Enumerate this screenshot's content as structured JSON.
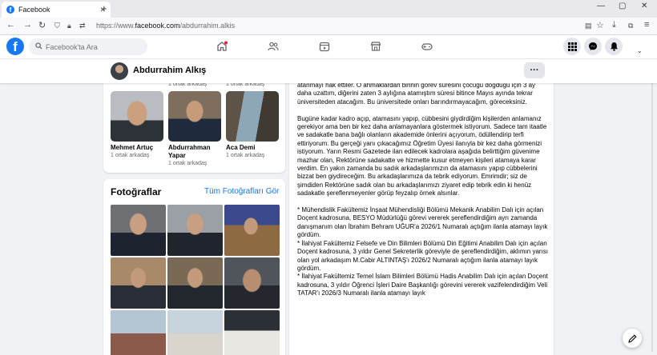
{
  "browser": {
    "tab_title": "Facebook",
    "tab_close": "✕",
    "new_tab": "+",
    "url_prefix": "https://www.",
    "url_host": "facebook.com",
    "url_path": "/abdurrahim.alkis",
    "window_controls": [
      "—",
      "▢",
      "✕"
    ]
  },
  "fb": {
    "search_placeholder": "Facebook'ta Ara",
    "accent": "#1877f2",
    "nav_icons": [
      "home-icon",
      "friends-icon",
      "watch-icon",
      "marketplace-icon",
      "gaming-icon"
    ],
    "right_icons": [
      "menu-grid-icon",
      "messenger-icon",
      "notifications-icon"
    ]
  },
  "profile": {
    "name": "Abdurrahim Alkış",
    "more": "···"
  },
  "friends": {
    "top_mutuals": [
      "1 ortak arkadaş",
      "1 ortak arkadaş"
    ],
    "items": [
      {
        "name": "Mehmet Artuç",
        "mutual": "1 ortak arkadaş"
      },
      {
        "name": "Abdurrahman Yapar",
        "mutual": "1 ortak arkadaş"
      },
      {
        "name": "Aca Demi",
        "mutual": "1 ortak arkadaş"
      }
    ]
  },
  "photos": {
    "title": "Fotoğraflar",
    "see_all": "Tüm Fotoğrafları Gör"
  },
  "post": {
    "paragraphs": [
      "atanmayı hak ettiler. O ahmaklardan birinin görev süresini çocuğu doğduğu için 3 ay daha uzattım, diğerini zaten 3 aylığına atamıştım süresi bitince Mayıs ayında tekrar üniversiteden atacağım. Bu üniversitede onları barındırmayacağım, göreceksiniz.",
      "Bugüne kadar kadro açıp, atamasını yapıp, cübbesini giydirdiğim kişilerden anlamanız gerekiyor ama ben bir kez daha anlamayanlara göstermek istiyorum. Sadece tam itaatle ve sadakatle bana bağlı olanların akademide önlerini açıyorum, ödüllendirip terfi ettiriyorum. Bu gerçeği yanı çıkacağımız Öğretim Üyesi ilanıyla bir kez daha görmenizi istiyorum. Yarın Resmi Gazetede ilan edilecek kadrolara aşağıda belirttiğim güvenime mazhar olan, Rektörüne sadakatte ve hizmette kusur etmeyen kişileri atamaya karar verdim. En yakın zamanda bu sadık arkadaşlarımızın da atamasını yapıp cübbelerini bizzat ben giydireceğim. Bu arkadaşlarımıza da tebrik ediyorum. Emrimdir; siz de şimdiden Rektörüne sadık olan bu arkadaşlarımızı ziyaret edip tebrik edin ki henüz sadakatle şereflenmeyenler görüp feyzalıp örnek alsınlar.",
      "* Mühendislik Fakültemiz İnşaat Mühendisliği Bölümü Mekanik Anabilim Dalı için açılan Doçent kadrosuna, BESYO Müdürlüğü görevi vererek şereflendirdiğim ayrı zamanda danışmanım olan İbrahim Behram UĞUR'a 2026/1 Numaralı açtığım ilanla atamayı layık gördüm.\n* İlahiyat Fakültemiz Felsefe ve Din Bilimleri Bölümü Din Eğitimi Anabilim Dalı için açılan Doçent kadrosuna, 3 yıldır Genel Sekreterlik göreviyle de şereflendirdiğim, aklımın yarısı olan yol arkadaşım M.Cabir ALTINTAŞ'ı 2026/2  Numaralı açtığım ilanla atamayı layık gördüm.\n* İlahiyat Fakültemiz Temel İslam Bilimleri Bölümü Hadis Anabilim Dalı için açılan Doçent kadrosuna, 3 yıldır Öğrenci İşleri Daire Başkanlığı görevini vererek vazifelendirdiğim Veli TATAR'ı 2026/3  Numaralı ilanla atamayı layık"
    ]
  }
}
